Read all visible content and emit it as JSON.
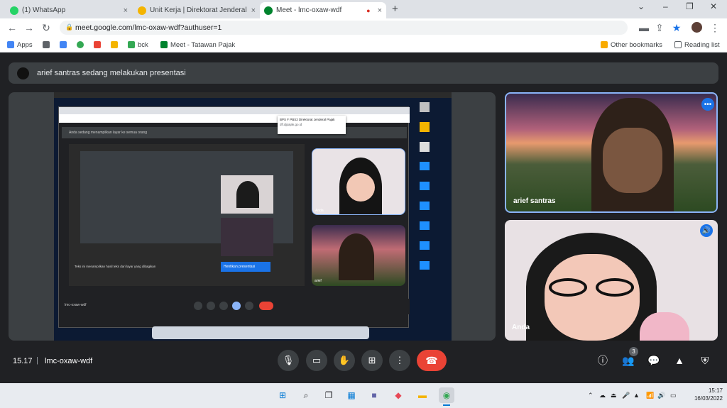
{
  "browser": {
    "tabs": [
      {
        "title": "(1) WhatsApp",
        "color": "#25d366",
        "active": false
      },
      {
        "title": "Unit Kerja | Direktorat Jenderal P",
        "color": "#f4b400",
        "active": false
      },
      {
        "title": "Meet - lmc-oxaw-wdf",
        "color": "#00832d",
        "active": true
      }
    ],
    "tab_close": "×",
    "new_tab": "+",
    "window_controls": [
      "⌄",
      "–",
      "❐",
      "✕"
    ],
    "url": "meet.google.com/lmc-oxaw-wdf?authuser=1",
    "bookmarks": [
      "Apps",
      "",
      "",
      "",
      "",
      "",
      "bck",
      "Meet - Tatawan Pajak"
    ],
    "other_bookmarks": "Other bookmarks",
    "reading_list": "Reading list"
  },
  "meet": {
    "presenting_banner": "arief santras sedang melakukan presentasi",
    "participants": [
      {
        "name": "arief santras",
        "more": "•••"
      },
      {
        "name": "Anda",
        "mic": "🔊"
      }
    ],
    "time": "15.17",
    "meeting_code": "lmc-oxaw-wdf",
    "participant_count": "3",
    "shared_screen": {
      "tooltip_title": "BPS F PBS2 Direktorat Jenderal Pajak",
      "tooltip_url": "dfl.djpajak.go.id",
      "banner": "Anda sedang menampilkan layar ke semua orang",
      "stop_label": "Hentikan presentasi",
      "caption": "Teks ini menampilkan hasil teks dari layar yang dibagikan",
      "inner_names": [
        "Anda",
        "arief"
      ],
      "inner_code": "lmc-oxaw-wdf"
    }
  },
  "taskbar": {
    "time": "15:17",
    "date": "16/03/2022"
  }
}
